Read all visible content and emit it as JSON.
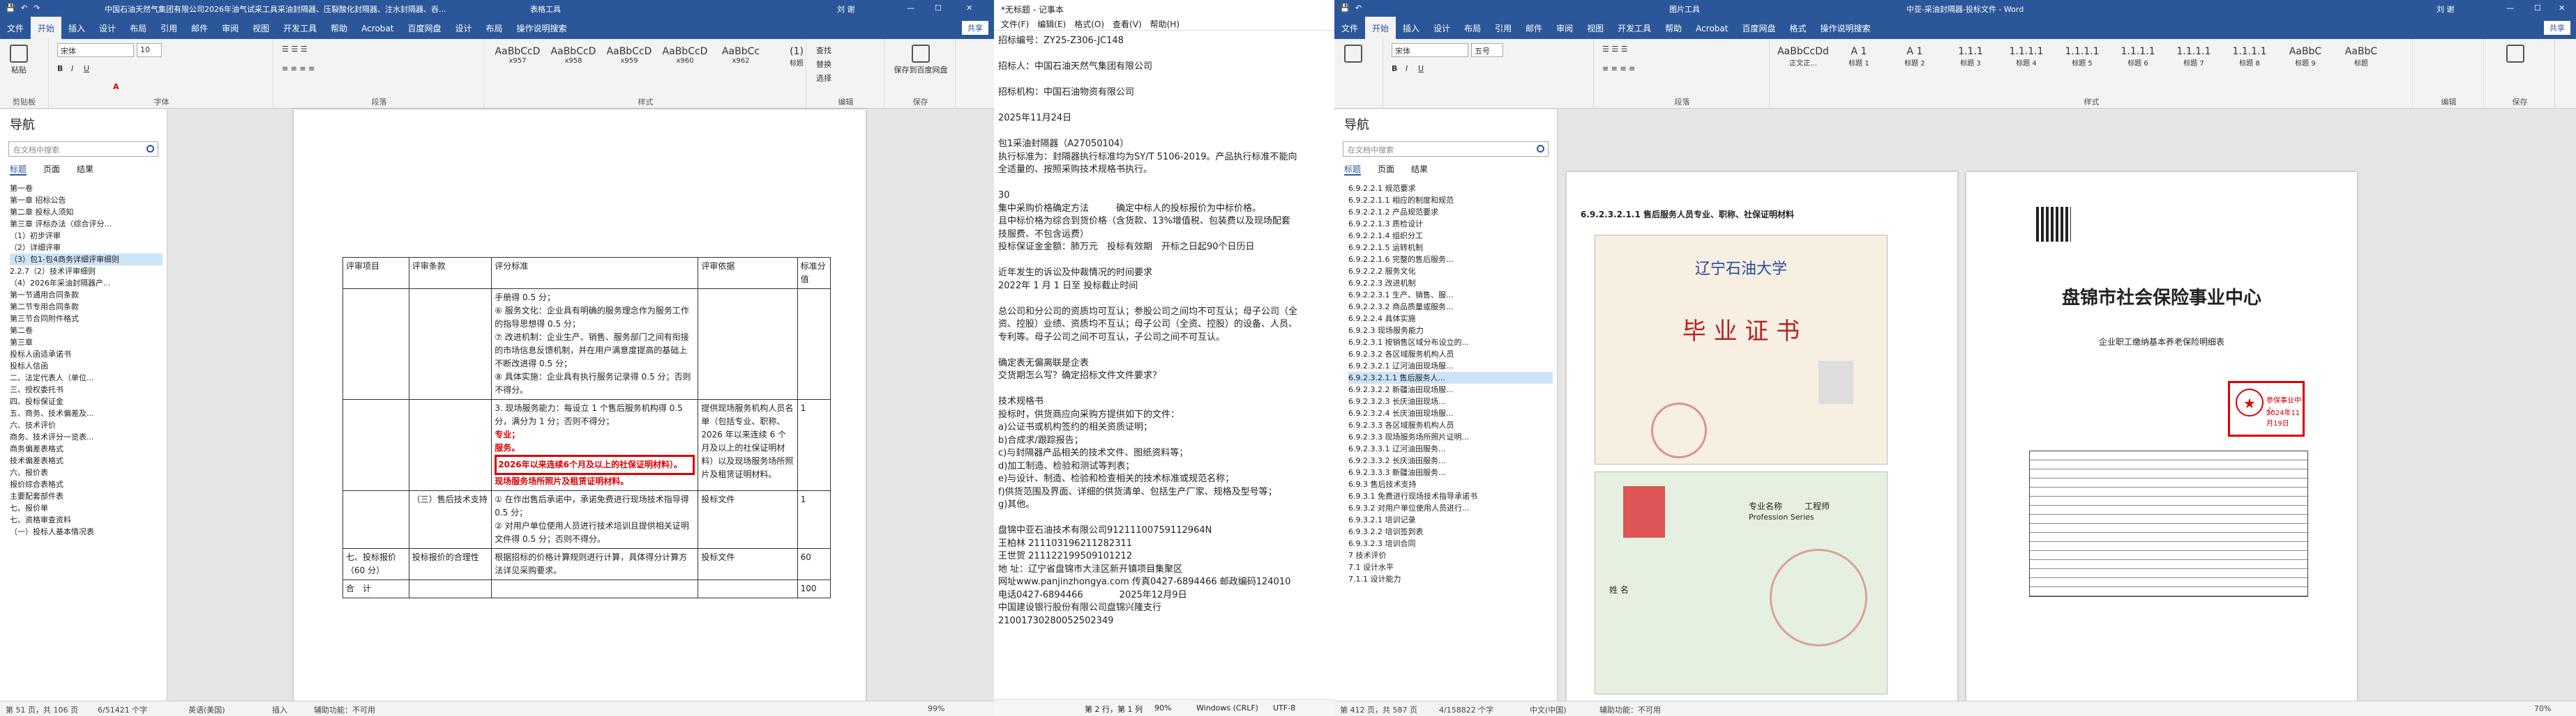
{
  "w1": {
    "title": "中国石油天然气集团有限公司2026年油气试采工具采油封隔器、压裂酸化封隔器、注水封隔器、吞...",
    "context_tab": "表格工具",
    "user": "刘 谢",
    "share": "共享",
    "tabs": [
      "文件",
      "开始",
      "插入",
      "设计",
      "布局",
      "引用",
      "邮件",
      "审阅",
      "视图",
      "开发工具",
      "帮助",
      "Acrobat",
      "百度网盘",
      "设计",
      "布局",
      "操作说明搜索"
    ],
    "ribbon": {
      "paste": "粘贴",
      "clipboard": "剪贴板",
      "font_name": "宋体",
      "font_size": "10",
      "font": "字体",
      "paragraph": "段落",
      "styles": "样式",
      "style_items": [
        "AaBbCcD",
        "AaBbCcD",
        "AaBbCcD",
        "AaBbCcD",
        "AaBbCc",
        "(1)"
      ],
      "style_names": [
        "x957",
        "x958",
        "x959",
        "x960",
        "x962",
        "标题"
      ],
      "find": "查找",
      "replace": "替换",
      "select": "选择",
      "edit": "编辑",
      "save_baidu": "保存到百度网盘",
      "save": "保存"
    },
    "nav": {
      "title": "导航",
      "search": "在文档中搜索",
      "tabs": [
        "标题",
        "页面",
        "结果"
      ],
      "items": [
        "第一卷",
        "第一章 招标公告",
        "第二章 投标人须知",
        "第三章 评标办法（综合评分...",
        "（1）初步评审",
        "（2）详细评审",
        "（3）包1-包4商务详细评审细则",
        "2.2.7（2）技术评审细则",
        "（4）2026年采油封隔器产...",
        "第一节通用合同条款",
        "第二节专用合同条款",
        "第三节合同附件格式",
        "第二卷",
        "第三章",
        "投标人函适承诺书",
        "投标人信函",
        "二、法定代表人（单位...",
        "三、授权委托书",
        "四、投标保证金",
        "五、商务、技术偏差及...",
        "六、技术评价",
        "商务、技术评分一览表...",
        "商务偏差表格式",
        "技术偏差表格式",
        "六、报价表",
        "报价综合表格式",
        "主要配套部件表",
        "七、报价单",
        "七、资格审查资料",
        "（一）投标人基本情况表"
      ]
    },
    "table": {
      "headers": [
        "评审项目",
        "评审条款",
        "评分标准",
        "评审依据",
        "标准分值"
      ],
      "r1_criteria": "手册得 0.5 分；\n⑥ 服务文化：企业具有明确的服务理念作为服务工作的指导思想得 0.5 分；\n⑦ 改进机制：企业生产、销售、服务部门之间有衔接的市场信息反馈机制，并在用户满意度提高的基础上不断改进得 0.5 分；\n⑧ 具体实施：企业具有执行服务记录得 0.5 分；否则不得分。",
      "r2_criteria_a": "3. 现场服务能力：每设立 1 个售后服务机构得 0.5 分，满分为 1 分；否则不得分；",
      "r2_criteria_b": "专业；\n服务。",
      "r2_red_box": "2026年以来连续6个月及以上的社保证明材料）。",
      "r2_red_tail": "现场服务场所照片及租赁证明材料。",
      "r2_basis": "提供现场服务机构人员名单（包括专业、职称、2026 年以来连续 6 个月及以上的社保证明材料）以及现场服务场所照片及租赁证明材料。",
      "r2_score": "1",
      "r3_item": "（三）售后技术支持",
      "r3_criteria": "① 在作出售后承诺中，承诺免费进行现场技术指导得 0.5 分；\n② 对用户单位使用人员进行技术培训且提供相关证明文件得 0.5 分；否则不得分。",
      "r3_basis": "投标文件",
      "r3_score": "1",
      "r4_item": "七、投标报价（60 分）",
      "r4_clause": "投标报价的合理性",
      "r4_criteria": "根据招标的价格计算规则进行计算，具体得分计算方法详见采购要求。",
      "r4_basis": "投标文件",
      "r4_score": "60",
      "total_label": "合　计",
      "total_score": "100"
    },
    "status": {
      "page": "第 51 页，共 106 页",
      "words": "6/51421 个字",
      "lang": "英语(美国)",
      "insert": "插入",
      "access": "辅助功能：不可用",
      "zoom": "99%"
    }
  },
  "w2": {
    "title": "*无标题 - 记事本",
    "menu": [
      "文件(F)",
      "编辑(E)",
      "格式(O)",
      "查看(V)",
      "帮助(H)"
    ],
    "lines": [
      "招标编号：ZY25-Z306-JC148",
      "",
      "招标人：中国石油天然气集团有限公司",
      "",
      "招标机构：中国石油物资有限公司",
      "",
      "2025年11月24日",
      "",
      "包1采油封隔器（A27050104）",
      "执行标准为：封隔器执行标准均为SY/T 5106-2019。产品执行标准不能向",
      "全适量的、按照采购技术规格书执行。",
      "",
      "30",
      "集中采购价格确定方法　　　确定中标人的投标报价为中标价格。",
      "且中标价格为综合到货价格（含货款、13%增值税、包装费以及现场配套",
      "技服费、不包含运费）",
      "投标保证金金额：肺万元　投标有效期　开标之日起90个日历日",
      "",
      "近年发生的诉讼及仲裁情况的时间要求",
      "2022年 1 月 1 日至 投标截止时间",
      "",
      "总公司和分公司的资质均可互认；参股公司之间均不可互认；母子公司（全",
      "资、控股）业绩、资质均不互认；母子公司（全资、控股）的设备、人员、",
      "专利等。母子公司之间不可互认，子公司之间不可互认。",
      "",
      "确定表无偏离联是企表",
      "交货期怎么写？确定招标文件文件要求？",
      "",
      "技术规格书",
      "投标时，供货商应向采购方提供如下的文件：",
      "a)公证书或机构签约的相关资质证明；",
      "b)合成求/跟踪报告；",
      "c)与封隔器产品相关的技术文件、图纸资料等；",
      "d)加工制造、检验和测试等判表；",
      "e)与设计、制造、检验和检查相关的技术标准或规范名称；",
      "f)供货范围及界面、详细的供货清单、包括生产厂家、规格及型号等；",
      "g)其他。",
      "",
      "盘锦中亚石油技术有限公司91211100759112964N",
      "王柏林 211103196211282311",
      "王世贺 211122199509101212",
      "地 址：辽宁省盘锦市大洼区新开镇项目集聚区",
      "网址www.panjinzhongya.com 传真0427-6894466 邮政编码124010",
      "电话0427-6894466　　　　2025年12月9日",
      "中国建设银行股份有限公司盘锦兴隆支行",
      "21001730280052502349"
    ],
    "status": {
      "pos": "第 2 行，第 1 列",
      "zoom": "90%",
      "eol": "Windows (CRLF)",
      "enc": "UTF-8"
    }
  },
  "w3": {
    "title": "中亚-采油封隔器-投标文件 - Word",
    "context_tab": "图片工具",
    "user": "刘 谢",
    "share": "共享",
    "tabs": [
      "文件",
      "开始",
      "插入",
      "设计",
      "布局",
      "引用",
      "邮件",
      "审阅",
      "视图",
      "开发工具",
      "帮助",
      "Acrobat",
      "百度网盘",
      "格式",
      "操作说明搜索"
    ],
    "ribbon": {
      "font_name": "宋体",
      "font_size": "五号",
      "style_items": [
        "AaBbCcDd",
        "A 1",
        "A 1",
        "1.1.1",
        "1.1.1.1",
        "1.1.1.1",
        "1.1.1.1",
        "1.1.1.1",
        "1.1.1.1",
        "AaBbC",
        "AaBbC"
      ],
      "style_names": [
        "正文正...",
        "标题 1",
        "标题 2",
        "标题 3",
        "标题 4",
        "标题 5",
        "标题 6",
        "标题 7",
        "标题 8",
        "标题 9",
        "标题"
      ],
      "paragraph": "段落",
      "styles": "样式",
      "edit": "编辑",
      "save": "保存"
    },
    "nav": {
      "title": "导航",
      "search": "在文档中搜索",
      "tabs": [
        "标题",
        "页面",
        "结果"
      ],
      "items": [
        "6.9.2.2.1 规范要求",
        "6.9.2.2.1.1 相应的制度和规范",
        "6.9.2.2.1.2 产品规范要求",
        "6.9.2.2.1.3 质检设计",
        "6.9.2.2.1.4 组织分工",
        "6.9.2.2.1.5 运转机制",
        "6.9.2.2.1.6 完整的售后服务...",
        "6.9.2.2.2 服务文化",
        "6.9.2.2.3 改进机制",
        "6.9.2.2.3.1 生产、销售、服...",
        "6.9.2.2.3.2 商品质量或服务...",
        "6.9.2.2.4 具体实施",
        "6.9.2.3 现场服务能力",
        "6.9.2.3.1 按销售区域分布设立的...",
        "6.9.2.3.2 各区域服务机构人员",
        "6.9.2.3.2.1 辽河油田现场服...",
        "6.9.2.3.2.1.1 售后服务人...",
        "6.9.2.3.2.2 新疆油田现场服...",
        "6.9.2.3.2.3 长庆油田现场...",
        "6.9.2.3.2.4 长庆油田现场服...",
        "6.9.2.3.3 各区域服务机构人员",
        "6.9.2.3.3 现场服务场所照片证明...",
        "6.9.2.3.3.1 辽河油田服务...",
        "6.9.2.3.3.2 长庆油田服务...",
        "6.9.2.3.3.3 新疆油田服务...",
        "6.9.3 售后技术支持",
        "6.9.3.1 免费进行现场技术指导承诺书",
        "6.9.3.2 对用户单位使用人员进行...",
        "6.9.3.2.1 培训记录",
        "6.9.3.2.2 培训签到表",
        "6.9.3.2.3 培训合同",
        "7 技术评价",
        "7.1 设计水平",
        "7.1.1 设计能力"
      ]
    },
    "page_left": {
      "heading": "6.9.2.3.2.1.1 售后服务人员专业、职称、社保证明材料",
      "cert_title": "毕 业 证 书",
      "cert_school": "辽宁石油大学",
      "id_card_label": "专业名称",
      "id_card_grade": "工程师",
      "id_card_en": "Profession Series",
      "name_label": "姓 名"
    },
    "page_right": {
      "org": "盘锦市社会保险事业中心",
      "sub": "企业职工缴纳基本养老保险明细表",
      "stamp": "参保事业中心",
      "date": "2024年11月19日"
    },
    "status": {
      "page": "第 412 页，共 587 页",
      "words": "4/158822 个字",
      "lang": "中文(中国)",
      "access": "辅助功能：不可用",
      "zoom": "70%"
    }
  }
}
